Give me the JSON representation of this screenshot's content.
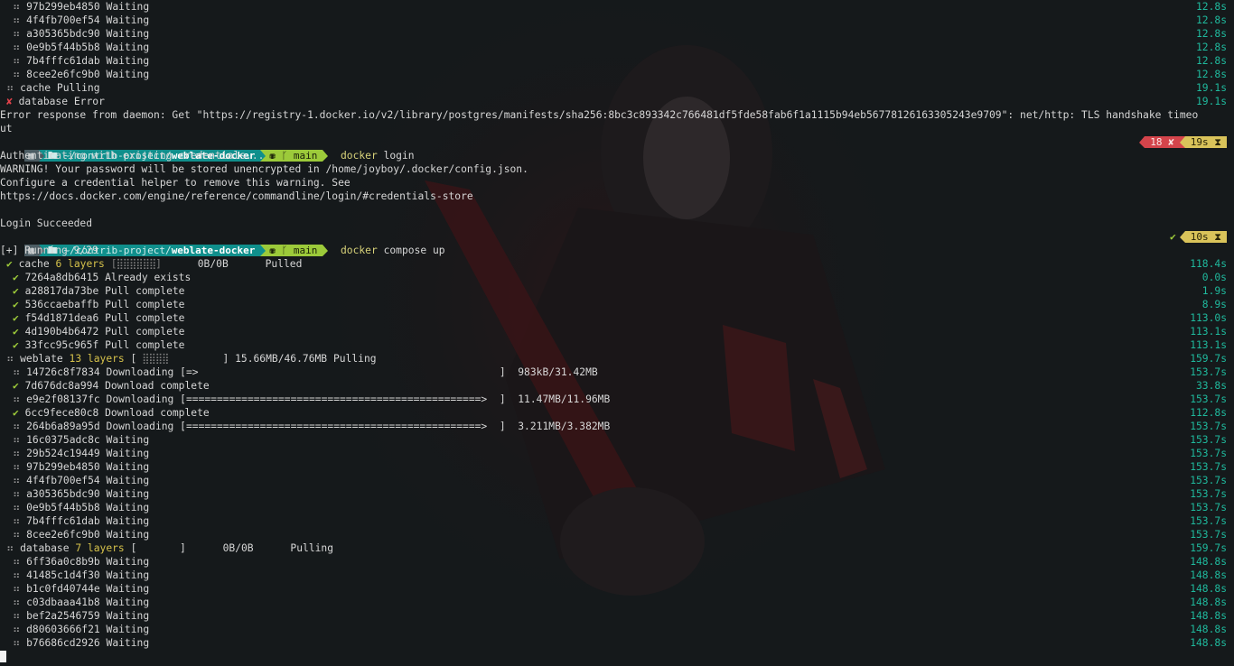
{
  "prev_rows": [
    {
      "id": "97b299eb4850",
      "status": "Waiting",
      "time": "12.8s"
    },
    {
      "id": "4f4fb700ef54",
      "status": "Waiting",
      "time": "12.8s"
    },
    {
      "id": "a305365bdc90",
      "status": "Waiting",
      "time": "12.8s"
    },
    {
      "id": "0e9b5f44b5b8",
      "status": "Waiting",
      "time": "12.8s"
    },
    {
      "id": "7b4fffc61dab",
      "status": "Waiting",
      "time": "12.8s"
    },
    {
      "id": "8cee2e6fc9b0",
      "status": "Waiting",
      "time": "12.8s"
    }
  ],
  "prev_cache": {
    "name": "cache",
    "status": "Pulling",
    "time": "19.1s"
  },
  "prev_db": {
    "name": "database",
    "status": "Error",
    "time": "19.1s"
  },
  "error_text": "Error response from daemon: Get \"https://registry-1.docker.io/v2/library/postgres/manifests/sha256:8bc3c893342c766481df5fde58fab6f1a1115b94eb56778126163305243e9709\": net/http: TLS handshake timeo",
  "error_tail": "ut",
  "prompt": {
    "os_icon": "terminal-icon",
    "path_prefix": "~/contrib-project/",
    "path_dir": "weblate-docker",
    "git_icons": "⛃ ᚴ",
    "branch": "main"
  },
  "prompt1": {
    "cmd": "docker",
    "args": " login",
    "err_count": "18",
    "err_mark": "✘",
    "duration": "19s",
    "hourglass": "⧗"
  },
  "login_lines": [
    "Authenticating with existing credentials...",
    "WARNING! Your password will be stored unencrypted in /home/joyboy/.docker/config.json.",
    "Configure a credential helper to remove this warning. See",
    "https://docs.docker.com/engine/reference/commandline/login/#credentials-store",
    "",
    "Login Succeeded"
  ],
  "prompt2": {
    "cmd": "docker",
    "args": " compose up",
    "ok_mark": "✔",
    "duration": "10s",
    "hourglass": "⧗"
  },
  "running": "[+] Running 9/29",
  "cache": {
    "name": "cache",
    "layers": "6 layers",
    "bar": "[⣿⣿⣿⣿⣿⣿]",
    "size": "0B/0B",
    "status": "Pulled",
    "time": "118.4s",
    "rows": [
      {
        "id": "7264a8db6415",
        "status": "Already exists",
        "time": "0.0s"
      },
      {
        "id": "a28817da73be",
        "status": "Pull complete",
        "time": "1.9s"
      },
      {
        "id": "536ccaebaffb",
        "status": "Pull complete",
        "time": "8.9s"
      },
      {
        "id": "f54d1871dea6",
        "status": "Pull complete",
        "time": "113.0s"
      },
      {
        "id": "4d190b4b6472",
        "status": "Pull complete",
        "time": "113.1s"
      },
      {
        "id": "33fcc95c965f",
        "status": "Pull complete",
        "time": "113.1s"
      }
    ]
  },
  "weblate": {
    "name": "weblate",
    "layers": "13 layers",
    "bar_open": "[",
    "bar_fill": " ⣿⣿⣿⣿ ",
    "bar_close": "        ]",
    "size": "15.66MB/46.76MB",
    "status": "Pulling",
    "time": "159.7s",
    "rows": [
      {
        "mark": "spin",
        "id": "14726c8f7834",
        "status": "Downloading",
        "progress": "[=>                                                 ]",
        "size": "  983kB/31.42MB",
        "time": "153.7s"
      },
      {
        "mark": "check",
        "id": "7d676dc8a994",
        "status": "Download complete",
        "progress": "",
        "size": "",
        "time": "33.8s"
      },
      {
        "mark": "spin",
        "id": "e9e2f08137fc",
        "status": "Downloading",
        "progress": "[================================================>  ]",
        "size": "  11.47MB/11.96MB",
        "time": "153.7s"
      },
      {
        "mark": "check",
        "id": "6cc9fece80c8",
        "status": "Download complete",
        "progress": "",
        "size": "",
        "time": "112.8s"
      },
      {
        "mark": "spin",
        "id": "264b6a89a95d",
        "status": "Downloading",
        "progress": "[================================================>  ]",
        "size": "  3.211MB/3.382MB",
        "time": "153.7s"
      },
      {
        "mark": "spin",
        "id": "16c0375adc8c",
        "status": "Waiting",
        "progress": "",
        "size": "",
        "time": "153.7s"
      },
      {
        "mark": "spin",
        "id": "29b524c19449",
        "status": "Waiting",
        "progress": "",
        "size": "",
        "time": "153.7s"
      },
      {
        "mark": "spin",
        "id": "97b299eb4850",
        "status": "Waiting",
        "progress": "",
        "size": "",
        "time": "153.7s"
      },
      {
        "mark": "spin",
        "id": "4f4fb700ef54",
        "status": "Waiting",
        "progress": "",
        "size": "",
        "time": "153.7s"
      },
      {
        "mark": "spin",
        "id": "a305365bdc90",
        "status": "Waiting",
        "progress": "",
        "size": "",
        "time": "153.7s"
      },
      {
        "mark": "spin",
        "id": "0e9b5f44b5b8",
        "status": "Waiting",
        "progress": "",
        "size": "",
        "time": "153.7s"
      },
      {
        "mark": "spin",
        "id": "7b4fffc61dab",
        "status": "Waiting",
        "progress": "",
        "size": "",
        "time": "153.7s"
      },
      {
        "mark": "spin",
        "id": "8cee2e6fc9b0",
        "status": "Waiting",
        "progress": "",
        "size": "",
        "time": "153.7s"
      }
    ]
  },
  "database": {
    "name": "database",
    "layers": "7 layers",
    "bar": "[       ]",
    "size": "0B/0B",
    "status": "Pulling",
    "time": "159.7s",
    "rows": [
      {
        "id": "6ff36a0c8b9b",
        "status": "Waiting",
        "time": "148.8s"
      },
      {
        "id": "41485c1d4f30",
        "status": "Waiting",
        "time": "148.8s"
      },
      {
        "id": "b1c0fd40744e",
        "status": "Waiting",
        "time": "148.8s"
      },
      {
        "id": "c03dbaaa41b8",
        "status": "Waiting",
        "time": "148.8s"
      },
      {
        "id": "bef2a2546759",
        "status": "Waiting",
        "time": "148.8s"
      },
      {
        "id": "d80603666f21",
        "status": "Waiting",
        "time": "148.8s"
      },
      {
        "id": "b76686cd2926",
        "status": "Waiting",
        "time": "148.8s"
      }
    ]
  },
  "glyphs": {
    "spin": "⠶",
    "check": "✔",
    "cross": "✘"
  },
  "colors": {
    "background": "#15191b",
    "time": "#1fb89c",
    "check": "#9fcd3a",
    "error": "#e2424b",
    "path_seg": "#0f8f8c",
    "git_seg": "#9cca3a",
    "err_seg": "#d4444b",
    "time_seg": "#d9c35a",
    "layers": "#d6c24b"
  }
}
